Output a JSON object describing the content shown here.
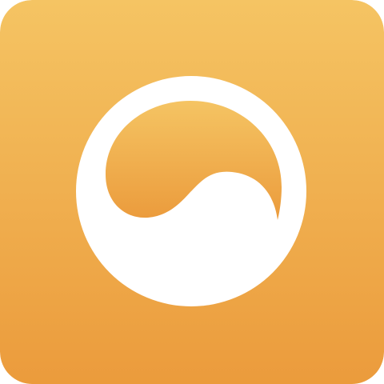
{
  "icon": {
    "name": "app-logo-icon",
    "colors": {
      "gradient_top": "#F5C463",
      "gradient_bottom": "#EB9B3C",
      "mark": "#FFFFFF"
    }
  }
}
